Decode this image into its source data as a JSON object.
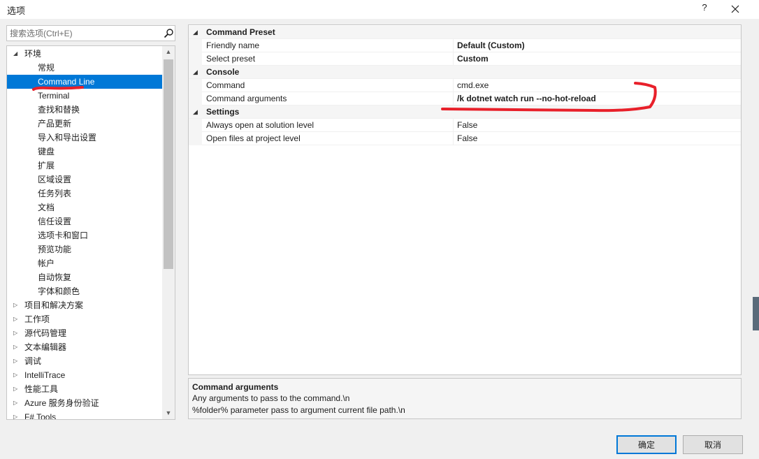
{
  "window": {
    "title": "选项",
    "help_label": "?"
  },
  "search": {
    "placeholder": "搜索选项(Ctrl+E)"
  },
  "tree": {
    "items": [
      {
        "label": "环境",
        "level": 0,
        "expander": "expanded"
      },
      {
        "label": "常规",
        "level": 1
      },
      {
        "label": "Command Line",
        "level": 1,
        "selected": true
      },
      {
        "label": "Terminal",
        "level": 1
      },
      {
        "label": "查找和替换",
        "level": 1
      },
      {
        "label": "产品更新",
        "level": 1
      },
      {
        "label": "导入和导出设置",
        "level": 1
      },
      {
        "label": "键盘",
        "level": 1
      },
      {
        "label": "扩展",
        "level": 1
      },
      {
        "label": "区域设置",
        "level": 1
      },
      {
        "label": "任务列表",
        "level": 1
      },
      {
        "label": "文档",
        "level": 1
      },
      {
        "label": "信任设置",
        "level": 1
      },
      {
        "label": "选项卡和窗口",
        "level": 1
      },
      {
        "label": "预览功能",
        "level": 1
      },
      {
        "label": "帐户",
        "level": 1
      },
      {
        "label": "自动恢复",
        "level": 1
      },
      {
        "label": "字体和颜色",
        "level": 1
      },
      {
        "label": "项目和解决方案",
        "level": 0,
        "expander": "collapsed"
      },
      {
        "label": "工作项",
        "level": 0,
        "expander": "collapsed"
      },
      {
        "label": "源代码管理",
        "level": 0,
        "expander": "collapsed"
      },
      {
        "label": "文本编辑器",
        "level": 0,
        "expander": "collapsed"
      },
      {
        "label": "调试",
        "level": 0,
        "expander": "collapsed"
      },
      {
        "label": "IntelliTrace",
        "level": 0,
        "expander": "collapsed"
      },
      {
        "label": "性能工具",
        "level": 0,
        "expander": "collapsed"
      },
      {
        "label": "Azure 服务身份验证",
        "level": 0,
        "expander": "collapsed"
      },
      {
        "label": "F# Tools",
        "level": 0,
        "expander": "collapsed"
      }
    ]
  },
  "grid": {
    "rows": [
      {
        "kind": "category",
        "name": "Command Preset"
      },
      {
        "kind": "property",
        "name": "Friendly name",
        "value": "Default (Custom)",
        "bold": true
      },
      {
        "kind": "property",
        "name": "Select preset",
        "value": "Custom",
        "bold": true
      },
      {
        "kind": "category",
        "name": "Console"
      },
      {
        "kind": "property",
        "name": "Command",
        "value": "cmd.exe",
        "bold": false
      },
      {
        "kind": "property",
        "name": "Command arguments",
        "value": "/k dotnet watch run --no-hot-reload",
        "bold": true
      },
      {
        "kind": "category",
        "name": "Settings"
      },
      {
        "kind": "property",
        "name": "Always open at solution level",
        "value": "False",
        "bold": false
      },
      {
        "kind": "property",
        "name": "Open files at project level",
        "value": "False",
        "bold": false
      }
    ]
  },
  "description": {
    "title": "Command arguments",
    "lines": [
      "Any arguments to pass to the command.\\n",
      "%folder% parameter pass to argument current file path.\\n"
    ]
  },
  "buttons": {
    "ok": "确定",
    "cancel": "取消"
  },
  "colors": {
    "selection": "#0078d7",
    "annotation": "#e8202a"
  }
}
